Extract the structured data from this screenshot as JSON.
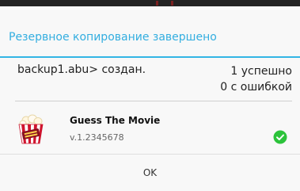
{
  "dialog": {
    "title": "Резервное копирование завершено",
    "summary": {
      "file_status": "backup1.abu> создан.",
      "success_count": "1 успешно",
      "error_count": "0 с ошибкой"
    },
    "items": [
      {
        "name": "Guess The Movie",
        "version": "v.1.2345678",
        "status_icon": "check-icon",
        "status_color": "#2cc33b"
      }
    ],
    "ok_label": "OK"
  },
  "colors": {
    "accent": "#33b5e5",
    "title_text": "#33aee0"
  }
}
